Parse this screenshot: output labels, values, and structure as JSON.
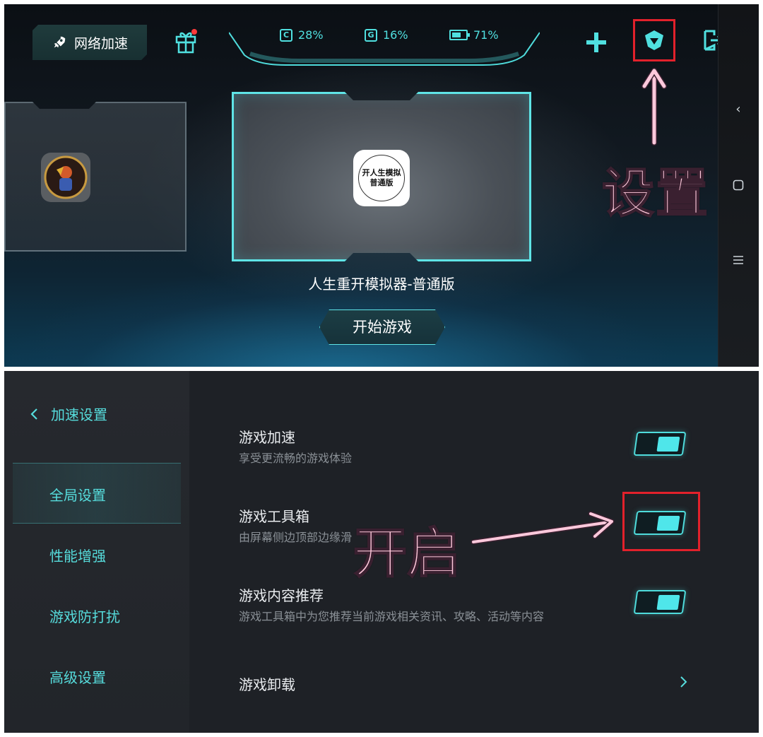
{
  "top": {
    "network_button": "网络加速",
    "status": {
      "cpu_label": "C",
      "cpu": "28%",
      "gpu_label": "G",
      "gpu": "16%",
      "battery": "71%"
    },
    "game_icon_text": [
      "开人生模拟",
      "普通版"
    ],
    "game_title": "人生重开模拟器-普通版",
    "start_button": "开始游戏",
    "annotation_settings": "设置"
  },
  "bottom": {
    "sidebar": {
      "header": "加速设置",
      "items": [
        {
          "label": "全局设置"
        },
        {
          "label": "性能增强"
        },
        {
          "label": "游戏防打扰"
        },
        {
          "label": "高级设置"
        }
      ]
    },
    "settings": [
      {
        "title": "游戏加速",
        "subtitle": "享受更流畅的游戏体验"
      },
      {
        "title": "游戏工具箱",
        "subtitle": "由屏幕侧边顶部边缘滑"
      },
      {
        "title": "游戏内容推荐",
        "subtitle": "游戏工具箱中为您推荐当前游戏相关资讯、攻略、活动等内容"
      },
      {
        "title": "游戏卸载"
      }
    ],
    "annotation_open": "开启"
  },
  "colors": {
    "accent": "#56dcdc",
    "highlight_box": "#e2212b",
    "annotation": "#ffc9dc"
  }
}
